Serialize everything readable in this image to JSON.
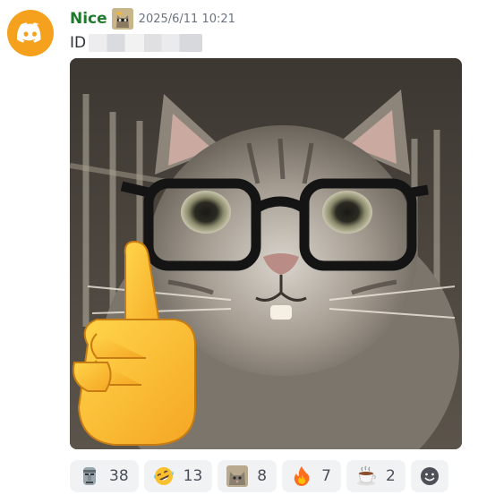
{
  "message": {
    "username": "Nice",
    "timestamp": "2025/6/11 10:21",
    "text_prefix": "ID",
    "username_color": "#1f7a2e",
    "avatar_color": "#f6a11d",
    "avatar_icon": "discord-logo-icon",
    "role_icon": "cat-sticker-icon"
  },
  "attachment": {
    "image_icon": "cat-with-glasses-pointing-finger-image"
  },
  "reactions": [
    {
      "icon": "moai-icon",
      "count": "38"
    },
    {
      "icon": "rofl-laughing-icon",
      "count": "13"
    },
    {
      "icon": "cat-sticker-icon",
      "count": "8"
    },
    {
      "icon": "fire-icon",
      "count": "7"
    },
    {
      "icon": "hot-beverage-icon",
      "count": "2"
    }
  ],
  "add_reaction_icon": "add-reaction-smiley-icon"
}
